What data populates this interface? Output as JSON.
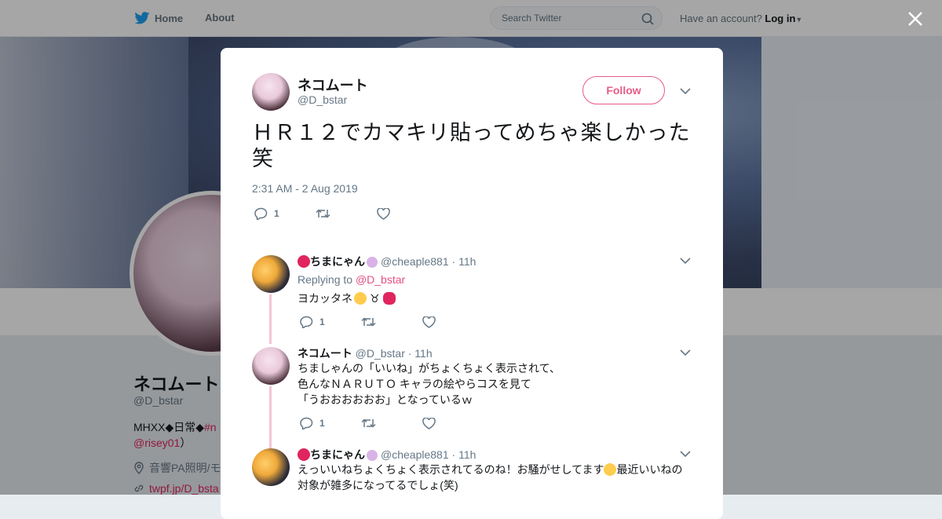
{
  "nav": {
    "home_label": "Home",
    "about_label": "About",
    "search_placeholder": "Search Twitter",
    "account_prompt": "Have an account?",
    "login_label": "Log in"
  },
  "profile": {
    "name": "ネコムート",
    "handle": "@D_bstar",
    "bio_start": "MHXX◆日常◆",
    "bio_link": "#n",
    "bio_mention": "@risey01",
    "bio_end": "）",
    "location": "音響PA照明/モ",
    "url": "twpf.jp/D_bsta"
  },
  "tweet": {
    "author_name": "ネコムート",
    "author_handle": "@D_bstar",
    "follow_label": "Follow",
    "text": "ＨＲ１２でカマキリ貼ってめちゃ楽しかった笑",
    "timestamp": "2:31 AM - 2 Aug 2019",
    "reply_count": "1",
    "retweet_count": "",
    "like_count": ""
  },
  "replies": [
    {
      "name": "ちまにゃん",
      "handle": "@cheaple881",
      "time": "· 11h",
      "replying_prefix": "Replying to",
      "replying_to": "@D_bstar",
      "text": "ヨカッタネ",
      "reply_count": "1",
      "retweet_count": "",
      "like_count": ""
    },
    {
      "name": "ネコムート",
      "handle": "@D_bstar",
      "time": "· 11h",
      "text_lines": [
        "ちましゃんの「いいね」がちょくちょく表示されて、",
        "色んなＮＡＲＵＴＯ キャラの絵やらコスを見て",
        "「うおおおおおお」となっているｗ"
      ],
      "reply_count": "1",
      "retweet_count": "",
      "like_count": ""
    },
    {
      "name": "ちまにゃん",
      "handle": "@cheaple881",
      "time": "· 11h",
      "text_line1_a": "えっいいねちょくちょく表示されてるのね！お騒がせしてます",
      "text_line1_b": "最近いいねの",
      "text_line2": "対象が雑多になってるでしょ(笑)"
    }
  ],
  "colors": {
    "accent": "#e0245e",
    "thread_line": "#f6c4d3",
    "twitter_blue": "#1da1f2"
  }
}
